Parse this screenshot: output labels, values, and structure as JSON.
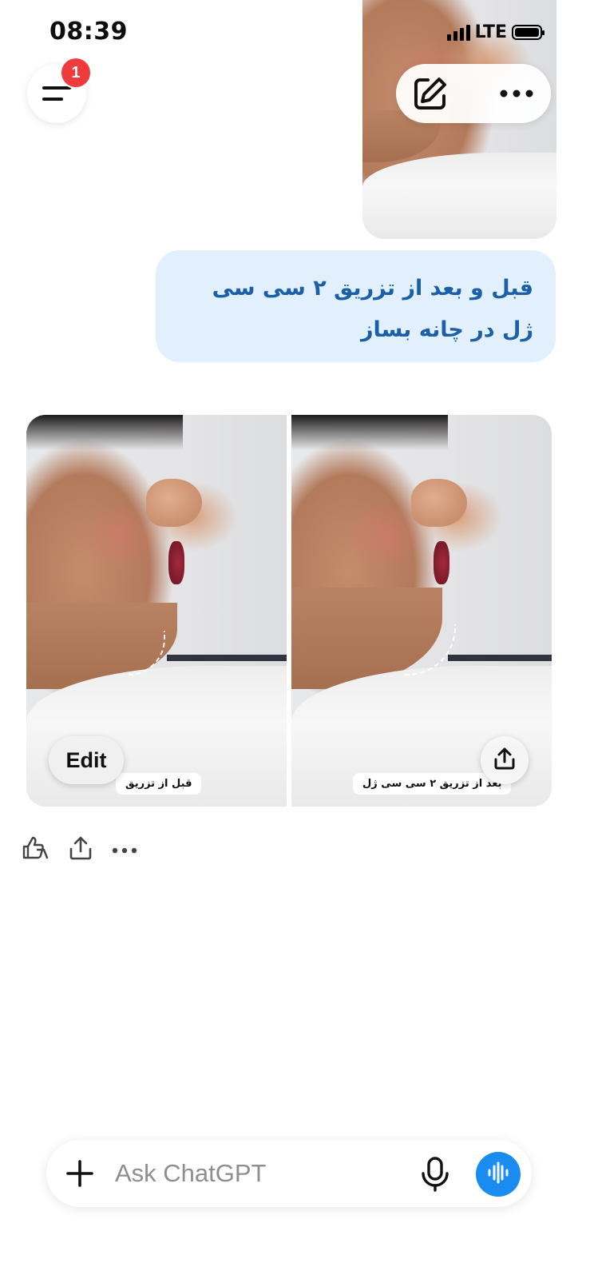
{
  "status_bar": {
    "time": "08:39",
    "network": "LTE",
    "battery_level": 1.0
  },
  "header": {
    "menu_badge": "1",
    "menu_icon": "menu-icon",
    "new_chat_icon": "edit-icon",
    "more_icon": "more-horizontal-icon"
  },
  "conversation": {
    "user_message": "قبل و بعد از تزریق ۲ سی سی ژل در چانه بساز",
    "assistant_image": {
      "before_caption": "قبل از تزریق",
      "after_caption": "بعد از تزریق ۲ سی سی ژل",
      "edit_label": "Edit",
      "share_icon": "share-icon"
    },
    "message_actions": [
      "thumbs-icon",
      "share-icon",
      "more-horizontal-icon"
    ]
  },
  "composer": {
    "placeholder": "Ask ChatGPT",
    "plus_icon": "plus-icon",
    "mic_icon": "microphone-icon",
    "voice_icon": "voice-mode-icon"
  },
  "colors": {
    "accent": "#1a8cf0",
    "user_bubble": "#e2f0fd",
    "user_text": "#1b5fa8",
    "badge": "#ef3b3b"
  }
}
